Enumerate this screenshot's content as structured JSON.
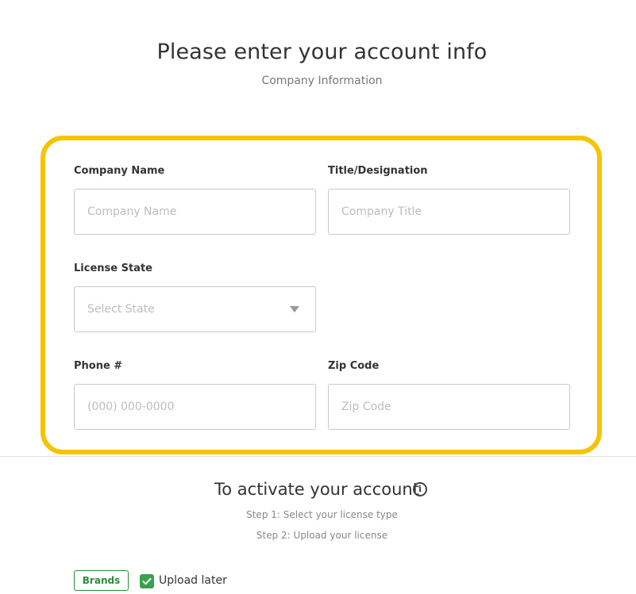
{
  "header": {
    "title": "Please enter your account info",
    "subtitle": "Company Information"
  },
  "form": {
    "company_name": {
      "label": "Company Name",
      "placeholder": "Company Name",
      "value": ""
    },
    "title_designation": {
      "label": "Title/Designation",
      "placeholder": "Company Title",
      "value": ""
    },
    "license_state": {
      "label": "License State",
      "placeholder": "Select State",
      "selected": ""
    },
    "phone": {
      "label": "Phone #",
      "placeholder": "(000) 000-0000",
      "value": ""
    },
    "zip": {
      "label": "Zip Code",
      "placeholder": "Zip Code",
      "value": ""
    }
  },
  "highlight_color": "#f5c400",
  "activation": {
    "title": "To activate your account",
    "info_icon": "info-icon",
    "info_glyph": "i",
    "step1": "Step 1: Select your license type",
    "step2": "Step 2: Upload your license"
  },
  "license_type": {
    "brands_label": "Brands",
    "brand_color": "#2e8b3a",
    "upload_later_label": "Upload later",
    "upload_later_checked": true,
    "checkbox_color": "#3aa152"
  }
}
